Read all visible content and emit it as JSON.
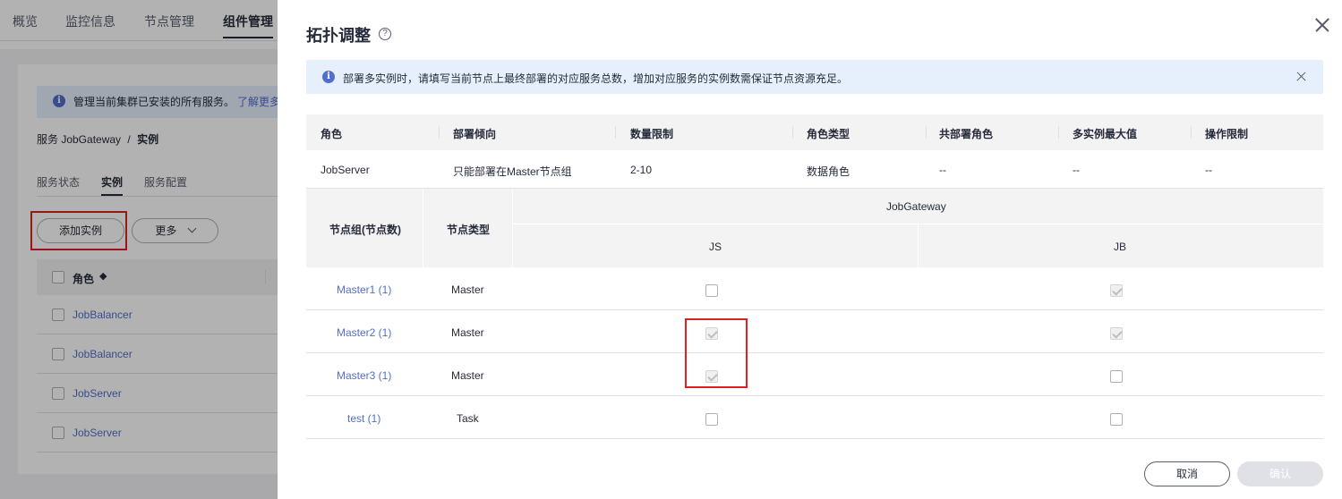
{
  "top_tabs": [
    "概览",
    "监控信息",
    "节点管理",
    "组件管理"
  ],
  "bg": {
    "info_text": "管理当前集群已安装的所有服务。",
    "info_link": "了解更多",
    "breadcrumb_service": "服务 JobGateway",
    "breadcrumb_sep": "/",
    "breadcrumb_current": "实例",
    "sub_tabs": [
      "服务状态",
      "实例",
      "服务配置"
    ],
    "add_instance_button": "添加实例",
    "more_button": "更多",
    "table_header_role": "角色",
    "rows": [
      "JobBalancer",
      "JobBalancer",
      "JobServer",
      "JobServer"
    ]
  },
  "drawer": {
    "title": "拓扑调整",
    "help_icon": "?",
    "info_icon": "i",
    "info_text": "部署多实例时，请填写当前节点上最终部署的对应服务总数，增加对应服务的实例数需保证节点资源充足。",
    "role_table": {
      "headers": [
        "角色",
        "部署倾向",
        "数量限制",
        "角色类型",
        "共部署角色",
        "多实例最大值",
        "操作限制"
      ],
      "row": [
        "JobServer",
        "只能部署在Master节点组",
        "2-10",
        "数据角色",
        "--",
        "--",
        "--"
      ]
    },
    "node_table": {
      "header_group": "节点组(节点数)",
      "header_type": "节点类型",
      "service": "JobGateway",
      "roles": [
        "JS",
        "JB"
      ],
      "rows": [
        {
          "group": "Master1 (1)",
          "type": "Master",
          "js": false,
          "jb": true
        },
        {
          "group": "Master2 (1)",
          "type": "Master",
          "js": true,
          "jb": true
        },
        {
          "group": "Master3 (1)",
          "type": "Master",
          "js": true,
          "jb": false
        },
        {
          "group": "test (1)",
          "type": "Task",
          "js": false,
          "jb": false
        }
      ]
    },
    "cancel_button": "取消",
    "confirm_button": "确认"
  },
  "colors": {
    "link": "#526ecc",
    "info_bg": "#e6f0fd",
    "highlight": "#e02020"
  }
}
